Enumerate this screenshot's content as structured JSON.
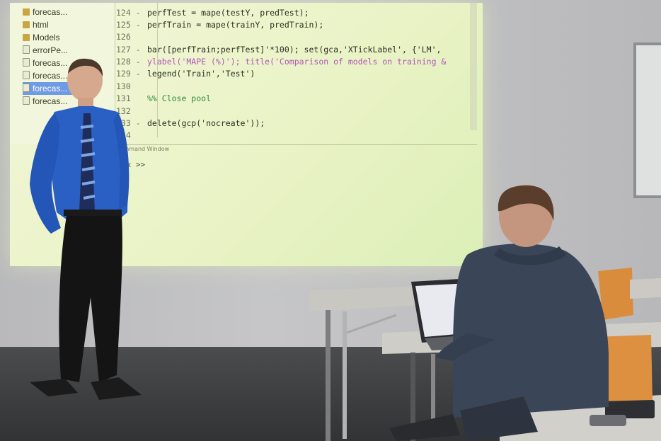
{
  "file_tree": {
    "items": [
      {
        "label": "forecas...",
        "kind": "folder",
        "selected": false
      },
      {
        "label": "html",
        "kind": "folder",
        "selected": false
      },
      {
        "label": "Models",
        "kind": "folder",
        "selected": false
      },
      {
        "label": "errorPe...",
        "kind": "file",
        "selected": false
      },
      {
        "label": "forecas...",
        "kind": "file",
        "selected": false
      },
      {
        "label": "forecas...",
        "kind": "file",
        "selected": false
      },
      {
        "label": "forecas...",
        "kind": "file",
        "selected": true
      },
      {
        "label": "forecas...",
        "kind": "file",
        "selected": false
      }
    ]
  },
  "editor": {
    "lines": [
      {
        "num": "124 -",
        "code": "perfTest = mape(testY, predTest);"
      },
      {
        "num": "125 -",
        "code": "perfTrain = mape(trainY, predTrain);"
      },
      {
        "num": "126",
        "code": ""
      },
      {
        "num": "127 -",
        "code": "bar([perfTrain;perfTest]'*100); set(gca,'XTickLabel', {'LM',"
      },
      {
        "num": "128 -",
        "code": "ylabel('MAPE (%)'); title('Comparison of models on training &"
      },
      {
        "num": "129 -",
        "code": "legend('Train','Test')"
      },
      {
        "num": "130",
        "code": ""
      },
      {
        "num": "131",
        "code": "%% Close pool"
      },
      {
        "num": "132",
        "code": ""
      },
      {
        "num": "133 -",
        "code": "delete(gcp('nocreate'));"
      },
      {
        "num": "134",
        "code": ""
      }
    ]
  },
  "command_window": {
    "header": "Command Window",
    "prompt": "fx >>"
  },
  "colors": {
    "shirt": "#2a5fc4",
    "hoodie": "#3a4658",
    "chair": "#d98d3c",
    "projection": "#eaf3c6"
  }
}
